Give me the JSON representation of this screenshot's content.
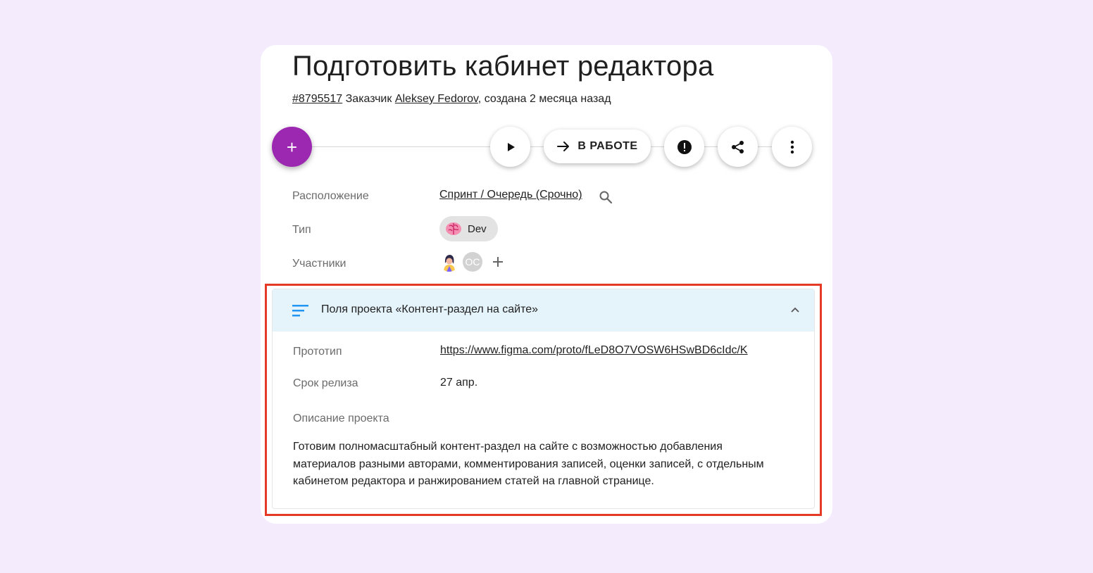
{
  "task": {
    "title": "Подготовить кабинет редактора",
    "id": "#8795517",
    "customer_prefix": "Заказчик",
    "customer": "Aleksey Fedorov",
    "created": ", создана 2 месяца назад"
  },
  "toolbar": {
    "add_label": "+",
    "status_label": "В РАБОТЕ",
    "icons": [
      "play-icon",
      "arrow-right-icon",
      "alert-icon",
      "share-icon",
      "more-vertical-icon"
    ]
  },
  "props": {
    "location_label": "Расположение",
    "location_value": "Спринт / Очередь (Срочно)",
    "type_label": "Тип",
    "type_value": "Dev",
    "members_label": "Участники",
    "member2_initials": "ОС"
  },
  "project_fields": {
    "header": "Поля проекта «Контент-раздел на сайте»",
    "prototype_label": "Прототип",
    "prototype_value": "https://www.figma.com/proto/fLeD8O7VOSW6HSwBD6cIdc/K",
    "release_label": "Срок релиза",
    "release_value": "27 апр.",
    "description_label": "Описание проекта",
    "description_value": "Готовим полномасштабный контент-раздел на сайте с возможностью добавления материалов разными авторами, комментирования записей, оценки записей, с отдельным кабинетом редактора и ранжированием статей на главной странице."
  },
  "colors": {
    "background": "#f4ebfd",
    "fab": "#9c27b0",
    "panel_header": "#e5f3fb",
    "accent_icon": "#2196f3",
    "highlight": "#e53a26"
  }
}
